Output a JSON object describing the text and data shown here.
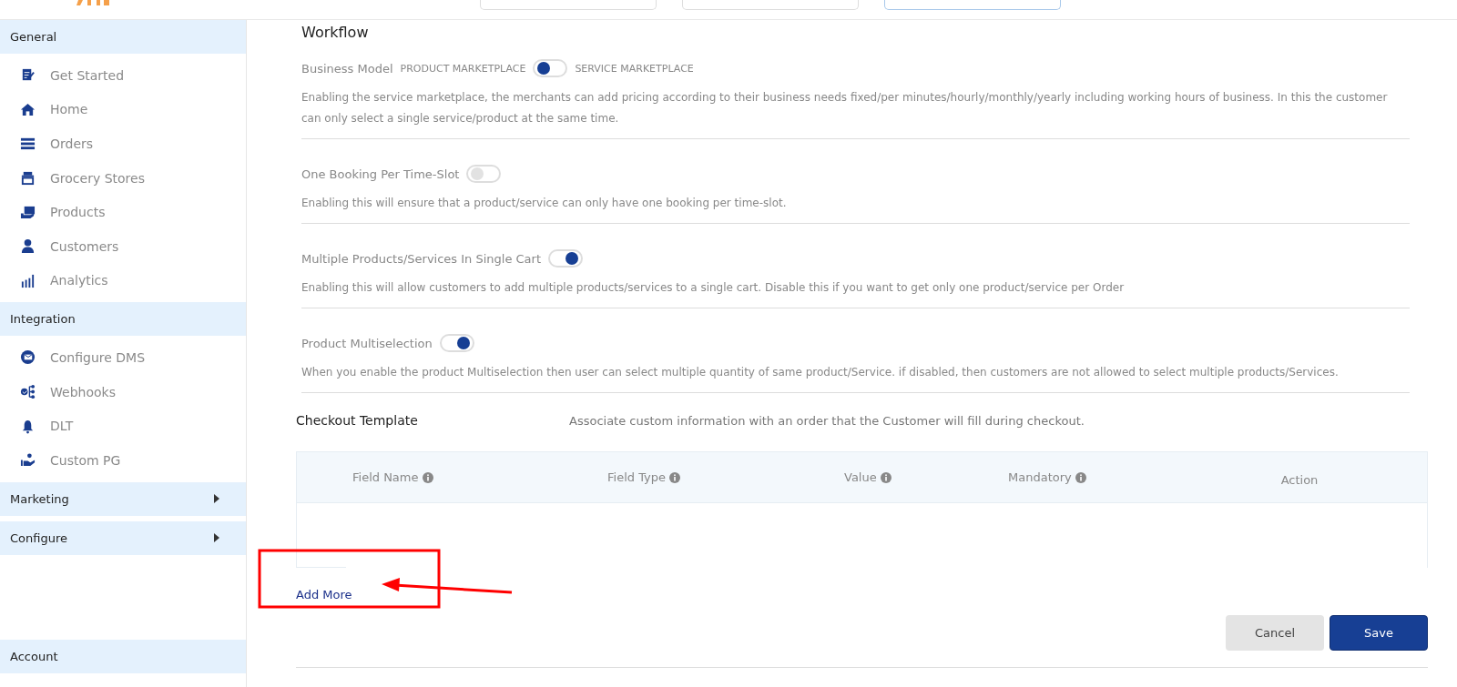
{
  "top_tabs": [
    {
      "selected": false
    },
    {
      "selected": false
    },
    {
      "selected": true
    }
  ],
  "sidebar": {
    "sections": [
      {
        "title": "General",
        "expandable": false,
        "items": [
          {
            "label": "Get Started"
          },
          {
            "label": "Home"
          },
          {
            "label": "Orders"
          },
          {
            "label": "Grocery Stores"
          },
          {
            "label": "Products"
          },
          {
            "label": "Customers"
          },
          {
            "label": "Analytics"
          }
        ]
      },
      {
        "title": "Integration",
        "expandable": false,
        "items": [
          {
            "label": "Configure DMS"
          },
          {
            "label": "Webhooks"
          },
          {
            "label": "DLT"
          },
          {
            "label": "Custom PG"
          }
        ]
      },
      {
        "title": "Marketing",
        "expandable": true
      },
      {
        "title": "Configure",
        "expandable": true
      }
    ],
    "footer_section": {
      "title": "Account"
    }
  },
  "workflow": {
    "title": "Workflow",
    "settings": [
      {
        "kind": "choice",
        "label": "Business Model",
        "left_label": "PRODUCT MARKETPLACE",
        "right_label": "SERVICE MARKETPLACE",
        "on": false,
        "description": "Enabling the service marketplace, the merchants can add pricing according to their business needs fixed/per minutes/hourly/monthly/yearly including working hours of business. In this the customer can only select a single service/product at the same time."
      },
      {
        "kind": "switch",
        "label": "One Booking Per Time-Slot",
        "on": false,
        "description": "Enabling this will ensure that a product/service can only have one booking per time-slot."
      },
      {
        "kind": "switch",
        "label": "Multiple Products/Services In Single Cart",
        "on": true,
        "description": "Enabling this will allow customers to add multiple products/services to a single cart. Disable this if you want to get only one product/service per Order"
      },
      {
        "kind": "switch",
        "label": "Product Multiselection",
        "on": true,
        "description": "When you enable the product Multiselection then user can select multiple quantity of same product/Service. if disabled, then customers are not allowed to select multiple products/Services."
      }
    ]
  },
  "checkout_template": {
    "title": "Checkout Template",
    "description": "Associate custom information with an order that the Customer will fill during checkout.",
    "table": {
      "columns": [
        {
          "label": "Field Name",
          "info": true
        },
        {
          "label": "Field Type",
          "info": true
        },
        {
          "label": "Value",
          "info": true
        },
        {
          "label": "Mandatory",
          "info": true
        },
        {
          "label": "Action",
          "info": false
        }
      ]
    },
    "add_link": "Add More",
    "buttons": [
      {
        "label": "Cancel",
        "kind": "secondary"
      },
      {
        "label": "Save",
        "kind": "primary"
      }
    ]
  }
}
